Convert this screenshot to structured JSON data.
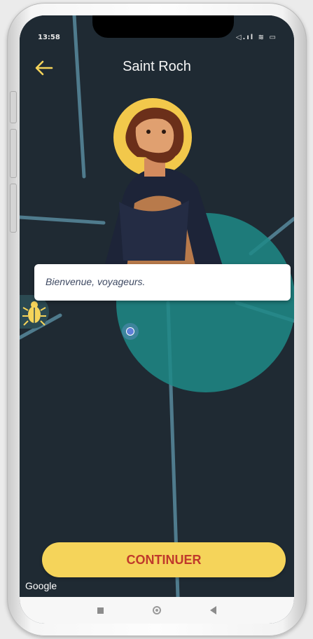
{
  "status_bar": {
    "time": "13:58",
    "icons": "◁.ıl ≋ ▭"
  },
  "header": {
    "back_icon": "arrow-left-icon",
    "title": "Saint Roch"
  },
  "dialog": {
    "text": "Bienvenue, voyageurs."
  },
  "map": {
    "attribution": "Google",
    "background_color": "#1f2a33",
    "road_color": "#4f7b8d",
    "zone_color": "#1e8a87"
  },
  "side_tab": {
    "icon": "bug-icon"
  },
  "action": {
    "continue_label": "CONTINUER",
    "button_color": "#f5d45a",
    "label_color": "#c0392b"
  },
  "nav_bar": {
    "items": [
      "recent-apps-icon",
      "home-icon",
      "back-icon"
    ]
  }
}
